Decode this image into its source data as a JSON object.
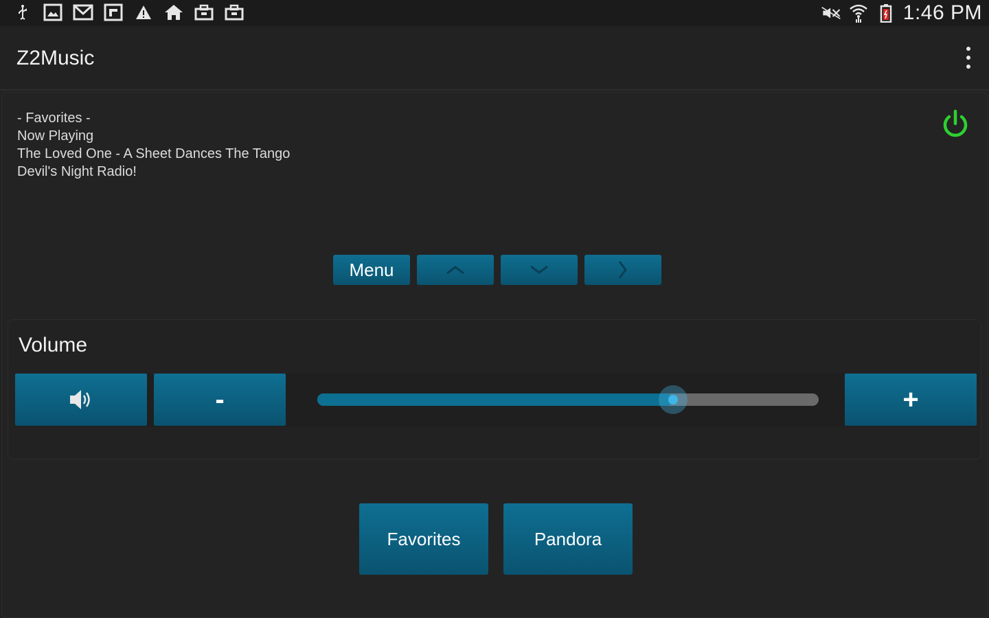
{
  "status_bar": {
    "left_icons": [
      "usb-icon",
      "image-icon",
      "gmail-icon",
      "flipboard-icon",
      "warning-icon",
      "home-icon",
      "briefcase-icon",
      "briefcase-icon"
    ],
    "right_icons": [
      "mute-icon",
      "wifi-icon",
      "battery-icon"
    ],
    "time": "1:46 PM"
  },
  "app_bar": {
    "title": "Z2Music"
  },
  "now_playing": {
    "source": " - Favorites -",
    "label": "Now Playing",
    "track": "The Loved One - A Sheet Dances The Tango",
    "station": "Devil's Night Radio!"
  },
  "power": {
    "color": "#2fd02f"
  },
  "nav": {
    "menu_label": "Menu",
    "up_icon": "chevron-up-icon",
    "down_icon": "chevron-down-icon",
    "right_icon": "chevron-right-icon"
  },
  "volume": {
    "title": "Volume",
    "decrease_label": "-",
    "increase_label": "+",
    "level_percent": 71
  },
  "bottom_buttons": {
    "favorites_label": "Favorites",
    "pandora_label": "Pandora"
  },
  "colors": {
    "accent": "#0c6486",
    "background": "#222222",
    "slider_fill": "#0d6f91",
    "slider_track": "#6a6a6a"
  }
}
